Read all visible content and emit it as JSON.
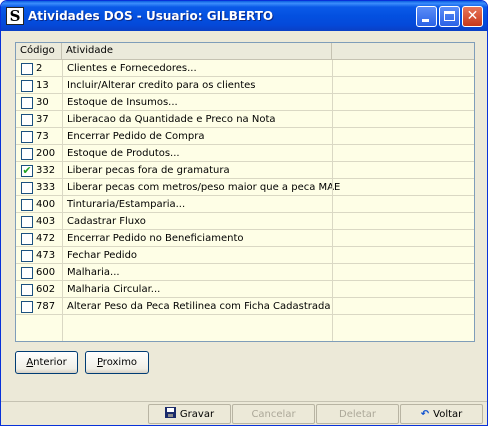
{
  "window": {
    "title": "Atividades DOS - Usuario: GILBERTO",
    "app_icon": "S",
    "controls": [
      "minimize",
      "maximize",
      "close"
    ]
  },
  "list": {
    "columns": [
      "Código",
      "Atividade"
    ],
    "rows": [
      {
        "code": "2",
        "label": "Clientes e Fornecedores...",
        "checked": false
      },
      {
        "code": "13",
        "label": "Incluir/Alterar credito para os clientes",
        "checked": false
      },
      {
        "code": "30",
        "label": "Estoque de Insumos...",
        "checked": false
      },
      {
        "code": "37",
        "label": "Liberacao da Quantidade e Preco na Nota",
        "checked": false
      },
      {
        "code": "73",
        "label": "Encerrar Pedido de Compra",
        "checked": false
      },
      {
        "code": "200",
        "label": "Estoque de Produtos...",
        "checked": false
      },
      {
        "code": "332",
        "label": "Liberar pecas fora de gramatura",
        "checked": true
      },
      {
        "code": "333",
        "label": "Liberar pecas com metros/peso maior que a peca MAE",
        "checked": false
      },
      {
        "code": "400",
        "label": "Tinturaria/Estamparia...",
        "checked": false
      },
      {
        "code": "403",
        "label": "Cadastrar Fluxo",
        "checked": false
      },
      {
        "code": "472",
        "label": "Encerrar Pedido no Beneficiamento",
        "checked": false
      },
      {
        "code": "473",
        "label": "Fechar Pedido",
        "checked": false
      },
      {
        "code": "600",
        "label": "Malharia...",
        "checked": false
      },
      {
        "code": "602",
        "label": "Malharia Circular...",
        "checked": false
      },
      {
        "code": "787",
        "label": "Alterar Peso da Peca Retilinea com Ficha Cadastrada",
        "checked": false
      }
    ]
  },
  "nav": {
    "prev_access": "A",
    "prev_rest": "nterior",
    "next_access": "P",
    "next_rest": "roximo"
  },
  "actions": {
    "save_access": "G",
    "save_rest": "ravar",
    "cancel_access": "C",
    "cancel_rest": "ancelar",
    "delete_pre": "Dele",
    "delete_access": "t",
    "delete_post": "ar",
    "back_access": "V",
    "back_rest": "oltar"
  }
}
